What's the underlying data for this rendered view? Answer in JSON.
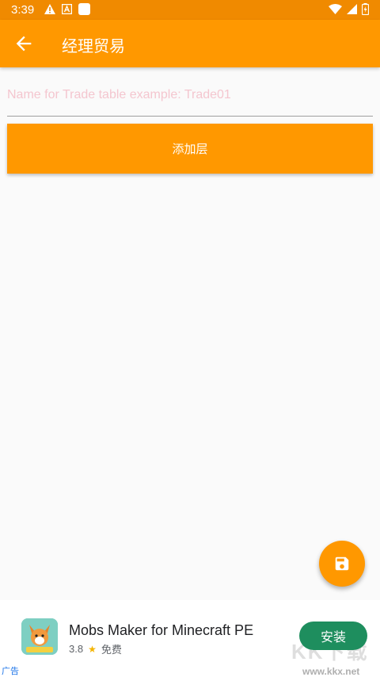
{
  "status_bar": {
    "time": "3:39"
  },
  "app_bar": {
    "title": "经理贸易"
  },
  "form": {
    "name_placeholder": "Name for Trade table example: Trade01",
    "name_value": "",
    "add_button_label": "添加层"
  },
  "ad": {
    "app_name": "Mobs Maker for Minecraft PE",
    "rating": "3.8",
    "price": "免费",
    "install_label": "安装",
    "ad_label": "广告"
  },
  "watermark": {
    "text": "KK下载",
    "url": "www.kkx.net"
  },
  "colors": {
    "accent": "#ff9800",
    "status_bar": "#f08a00",
    "install": "#1e8e5e"
  }
}
